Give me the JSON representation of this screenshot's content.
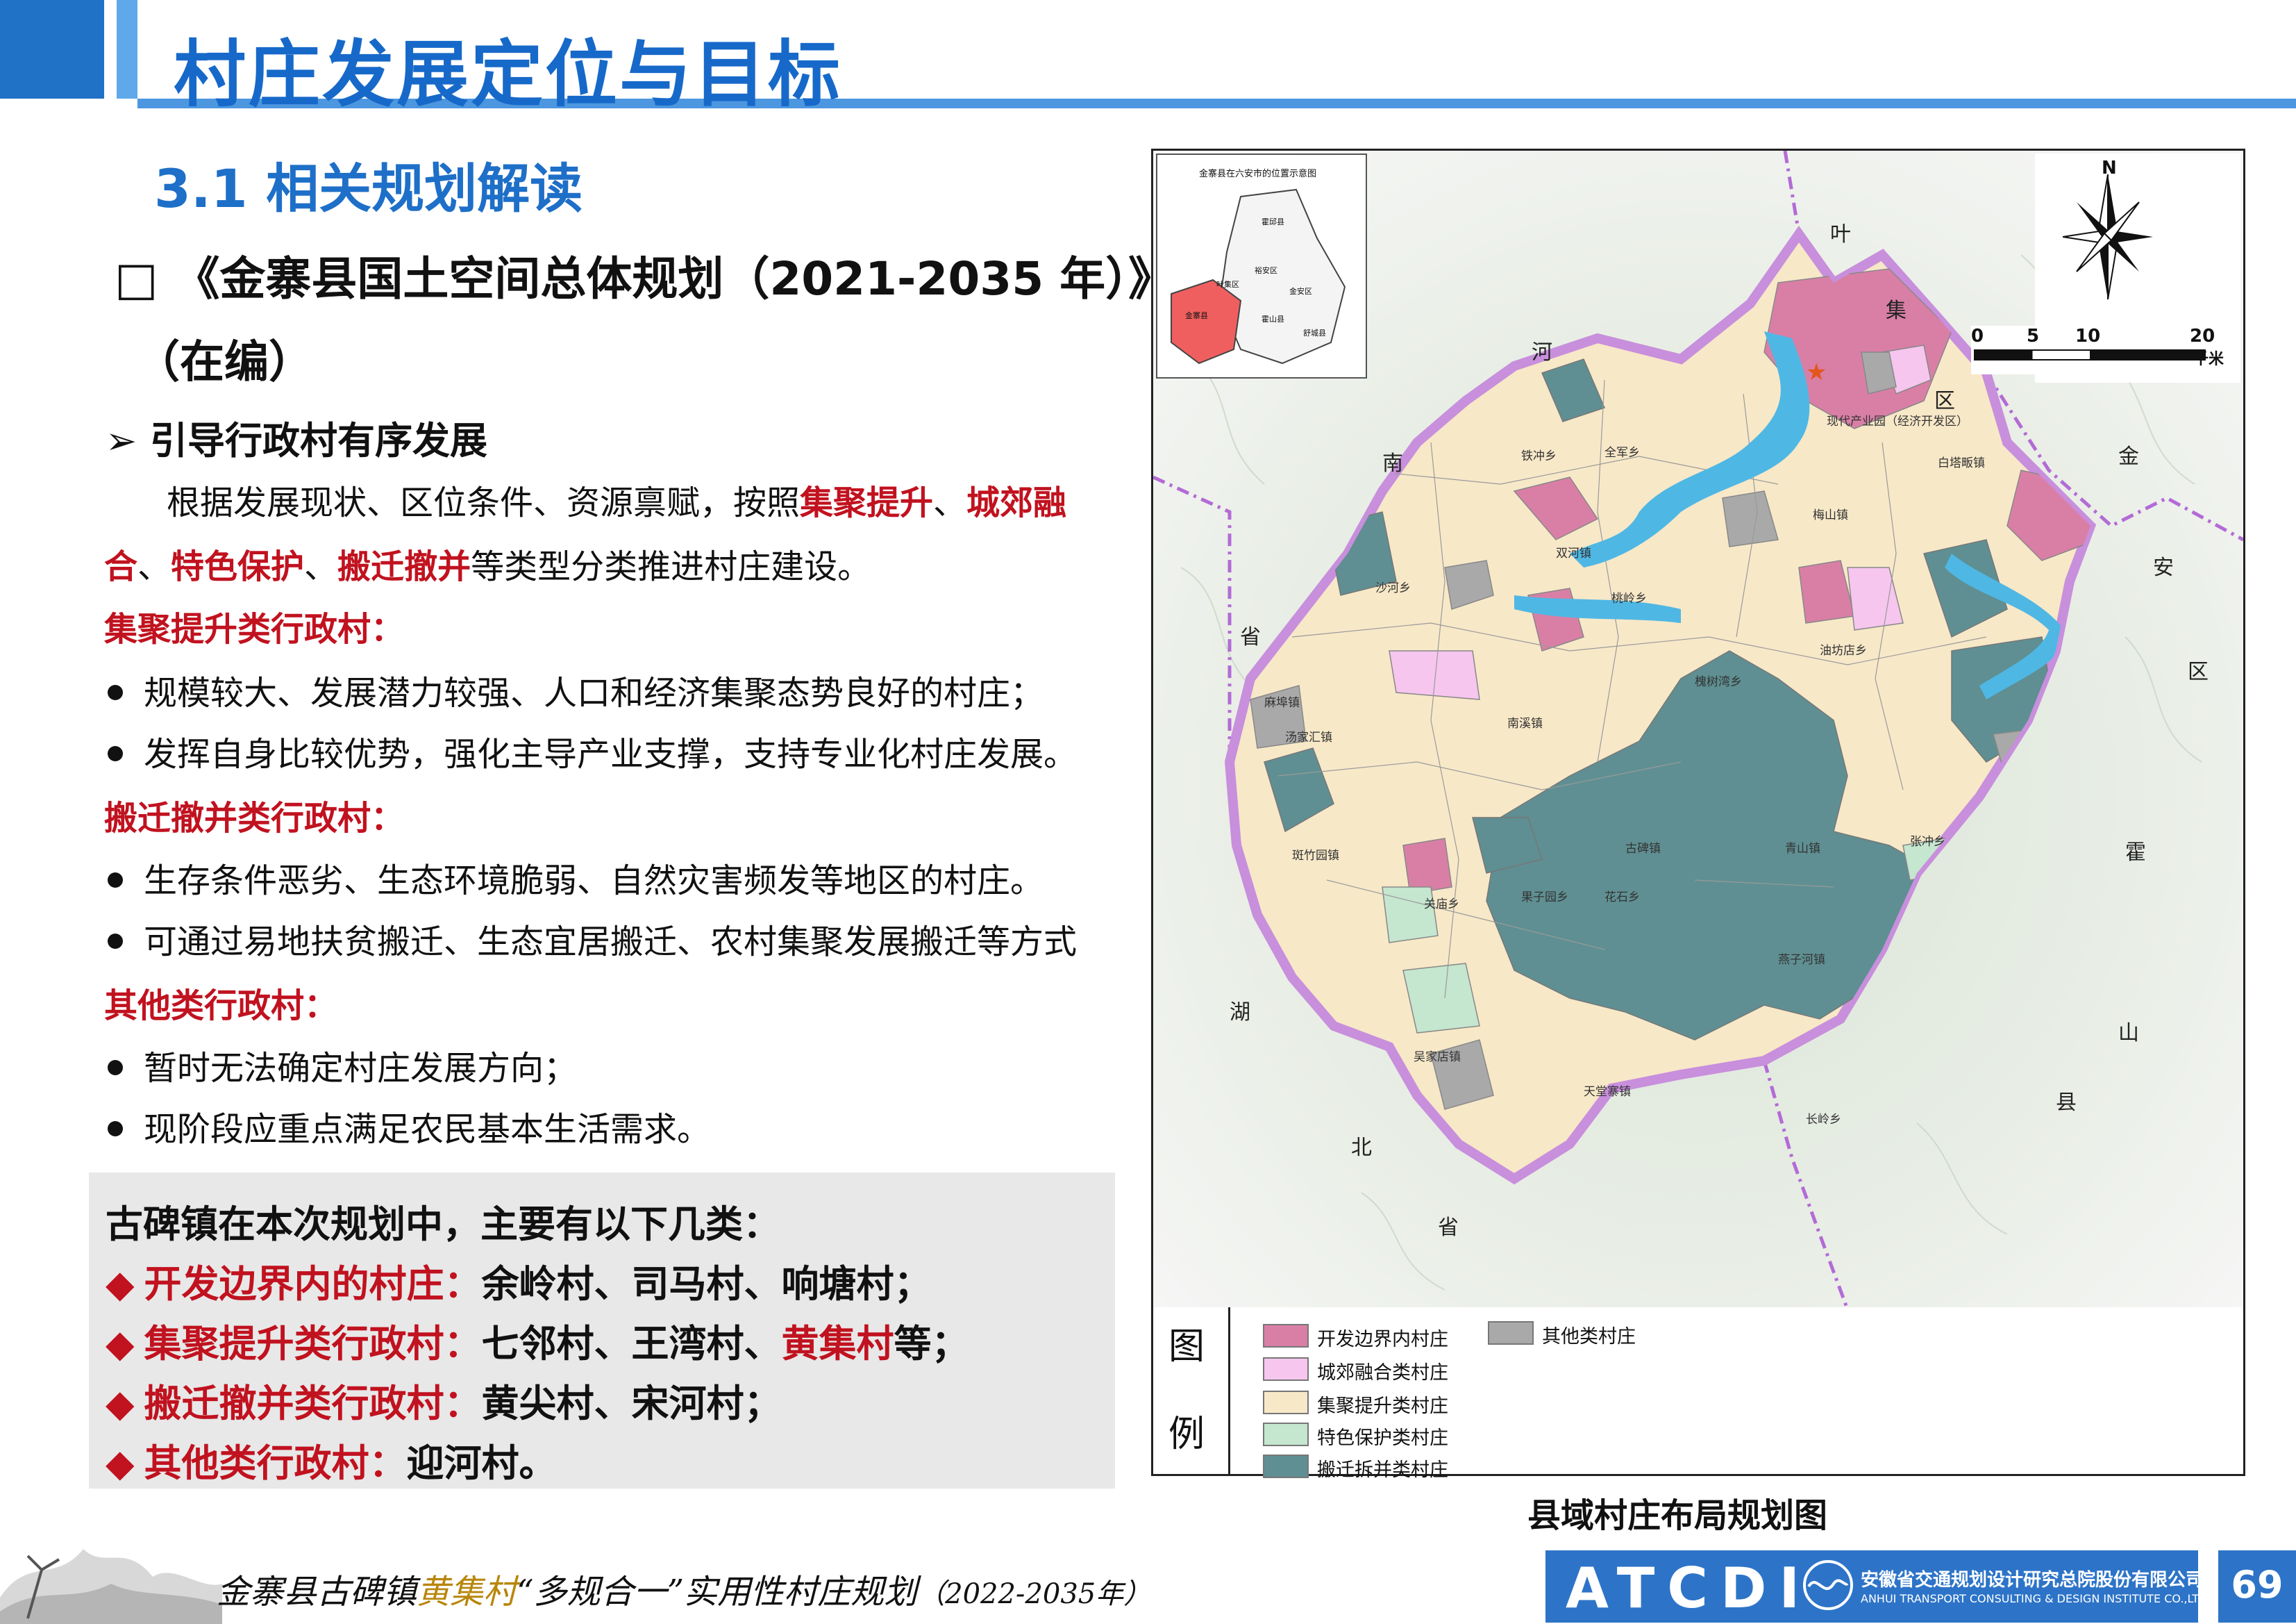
{
  "header": {
    "title": "村庄发展定位与目标"
  },
  "section": {
    "subtitle": "3.1 相关规划解读",
    "plan_title": "□ 《金寨县国土空间总体规划（2021-2035 年）》",
    "plan_status": "（在编）",
    "guide_heading": "➢ 引导行政村有序发展",
    "intro": {
      "t1": "根据发展现状、区位条件、资源禀赋，按照",
      "r1": "集聚提升",
      "t2": "、",
      "r2": "城郊融合",
      "t3": "、",
      "r3": "特色保护",
      "t4": "、",
      "r4": "搬迁撤并",
      "t5": "等类型分类推进村庄建设。"
    },
    "cat1": {
      "heading": "集聚提升类行政村：",
      "items": [
        "规模较大、发展潜力较强、人口和经济集聚态势良好的村庄；",
        "发挥自身比较优势，强化主导产业支撑，支持专业化村庄发展。"
      ]
    },
    "cat2": {
      "heading": "搬迁撤并类行政村：",
      "items": [
        "生存条件恶劣、生态环境脆弱、自然灾害频发等地区的村庄。",
        "可通过易地扶贫搬迁、生态宜居搬迁、农村集聚发展搬迁等方式"
      ]
    },
    "cat3": {
      "heading": "其他类行政村：",
      "items": [
        "暂时无法确定村庄发展方向；",
        "现阶段应重点满足农民基本生活需求。"
      ]
    }
  },
  "summary": {
    "title": "古碑镇在本次规划中，主要有以下几类：",
    "rows": [
      {
        "label": "开发边界内的村庄：",
        "text": "余岭村、司马村、响塘村；",
        "highlight": "",
        "tail": ""
      },
      {
        "label": "集聚提升类行政村：",
        "text": "七邻村、王湾村、",
        "highlight": "黄集村",
        "tail": "等；"
      },
      {
        "label": "搬迁撤并类行政村：",
        "text": "黄尖村、宋河村；",
        "highlight": "",
        "tail": ""
      },
      {
        "label": "其他类行政村：",
        "text": "迎河村。",
        "highlight": "",
        "tail": ""
      }
    ]
  },
  "map": {
    "inset_title": "金寨县在六安市的位置示意图",
    "inset_labels": [
      "霍邱县",
      "裕安区",
      "金安区",
      "霍山县",
      "舒城县",
      "叶集区",
      "金寨县"
    ],
    "north": "N",
    "scale": {
      "ticks": [
        "0",
        "5",
        "10",
        "20"
      ],
      "unit": "千米"
    },
    "region_labels": [
      "叶",
      "集",
      "区",
      "河",
      "南",
      "省",
      "金",
      "安",
      "区",
      "霍",
      "山",
      "县",
      "湖",
      "北",
      "省"
    ],
    "town_labels": [
      "现代产业园（经济开发区）",
      "梅山镇",
      "白塔畈镇",
      "铁冲乡",
      "全军乡",
      "双河镇",
      "桃岭乡",
      "沙河乡",
      "槐树湾乡",
      "油坊店乡",
      "南溪镇",
      "古碑镇",
      "燕子河镇",
      "青山镇",
      "张冲乡",
      "吴家店镇",
      "天堂寨镇",
      "长岭乡",
      "花石乡",
      "果子园乡",
      "关庙乡",
      "麻埠镇",
      "汤家汇镇",
      "斑竹园镇"
    ],
    "legend_title_1": "图",
    "legend_title_2": "例",
    "legend": [
      {
        "label": "开发边界内村庄",
        "color": "#d97fa6"
      },
      {
        "label": "城郊融合类村庄",
        "color": "#f6c6ee"
      },
      {
        "label": "集聚提升类村庄",
        "color": "#f7e8c8"
      },
      {
        "label": "特色保护类村庄",
        "color": "#c5e6cf"
      },
      {
        "label": "搬迁拆并类村庄",
        "color": "#5f8f92"
      },
      {
        "label": "其他类村庄",
        "color": "#a9a9a9"
      }
    ],
    "caption": "县域村庄布局规划图"
  },
  "footer": {
    "text_a": "金寨县古碑镇",
    "text_b": "黄集村",
    "text_c": "“多规合一”实用性村庄规划",
    "text_d": "（2022-2035年）",
    "logo": "ATCDI",
    "company_cn": "安徽省交通规划设计研究总院股份有限公司",
    "company_en": "ANHUI TRANSPORT CONSULTING & DESIGN INSTITUTE CO.,LTD.",
    "page": "69"
  }
}
